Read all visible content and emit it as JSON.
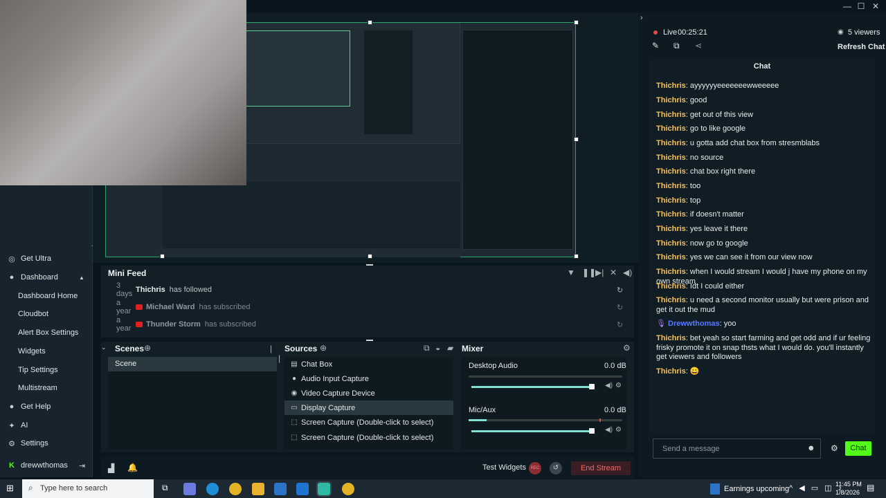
{
  "window": {
    "minimize": "—",
    "maximize": "☐",
    "close": "✕"
  },
  "sidebar": {
    "items": [
      {
        "icon": "get-ultra-icon",
        "glyph": "◎",
        "label": "Get Ultra"
      },
      {
        "icon": "dashboard-icon",
        "glyph": "●",
        "label": "Dashboard"
      },
      {
        "label": "Dashboard Home"
      },
      {
        "label": "Cloudbot"
      },
      {
        "label": "Alert Box Settings"
      },
      {
        "label": "Widgets"
      },
      {
        "label": "Tip Settings"
      },
      {
        "label": "Multistream"
      },
      {
        "icon": "help-icon",
        "glyph": "●",
        "label": "Get Help"
      },
      {
        "icon": "ai-icon",
        "glyph": "✦",
        "label": "AI"
      },
      {
        "icon": "settings-icon",
        "glyph": "⚙",
        "label": "Settings"
      },
      {
        "icon": "kick-icon",
        "glyph": "K",
        "label": "drewwthomas"
      }
    ]
  },
  "minifeed": {
    "title": "Mini Feed",
    "rows": [
      {
        "time": "3 days",
        "name": "Thichris",
        "action": "has followed",
        "platform": ""
      },
      {
        "time": "a year",
        "name": "Michael Ward",
        "action": "has subscribed",
        "platform": "youtube"
      },
      {
        "time": "a year",
        "name": "Thunder Storm",
        "action": "has subscribed",
        "platform": "youtube"
      }
    ]
  },
  "scenes": {
    "title": "Scenes",
    "items": [
      "Scene"
    ]
  },
  "sources": {
    "title": "Sources",
    "items": [
      {
        "icon": "chat-icon",
        "glyph": "💬",
        "label": "Chat Box"
      },
      {
        "icon": "mic-icon",
        "glyph": "●",
        "label": "Audio Input Capture"
      },
      {
        "icon": "camera-icon",
        "glyph": "◉",
        "label": "Video Capture Device"
      },
      {
        "icon": "monitor-icon",
        "glyph": "▭",
        "label": "Display Capture",
        "selected": true
      },
      {
        "icon": "screen-capture-icon",
        "glyph": "⬚",
        "label": "Screen Capture (Double-click to select)"
      },
      {
        "icon": "screen-capture-icon",
        "glyph": "⬚",
        "label": "Screen Capture (Double-click to select)"
      }
    ]
  },
  "mixer": {
    "title": "Mixer",
    "channels": [
      {
        "name": "Desktop Audio",
        "level": "0.0 dB",
        "volume": 0.98
      },
      {
        "name": "Mic/Aux",
        "level": "0.0 dB",
        "volume": 0.98
      }
    ]
  },
  "footer": {
    "test_widgets": "Test Widgets",
    "rec": "REC",
    "end_stream": "End Stream"
  },
  "chat": {
    "live_label": "Live",
    "live_time": "00:25:21",
    "viewers": "5 viewers",
    "refresh": "Refresh Chat",
    "title": "Chat",
    "messages": [
      {
        "user": "Thichris",
        "text": ": ayyyyyyeeeeeeewweeeee"
      },
      {
        "user": "Thichris",
        "text": ": good"
      },
      {
        "user": "Thichris",
        "text": ": get out of this view"
      },
      {
        "user": "Thichris",
        "text": ": go to like google"
      },
      {
        "user": "Thichris",
        "text": ": u gotta add chat box from stresmblabs"
      },
      {
        "user": "Thichris",
        "text": ": no source"
      },
      {
        "user": "Thichris",
        "text": ": chat box right there"
      },
      {
        "user": "Thichris",
        "text": ": too"
      },
      {
        "user": "Thichris",
        "text": ": top"
      },
      {
        "user": "Thichris",
        "text": ": if doesn't matter"
      },
      {
        "user": "Thichris",
        "text": ": yes leave it there"
      },
      {
        "user": "Thichris",
        "text": ": now go to google"
      },
      {
        "user": "Thichris",
        "text": ": yes we can see it from our view now"
      },
      {
        "user": "Thichris",
        "text": ": when I would stream I would j have my phone on my own stream"
      },
      {
        "user": "Thichris",
        "text": ": Idt I could either"
      },
      {
        "user": "Thichris",
        "text": ": u need a second monitor usually but were prison and get it out the mud"
      },
      {
        "user": "Drewwthomas",
        "text": ": yoo",
        "blue": true
      },
      {
        "user": "Thichris",
        "text": ": bet yeah so start farming and get odd and if ur feeling frisky promote it on snap thsts what I would do. you'll instantly get viewers and followers"
      },
      {
        "user": "Thichris",
        "text": ": 😀"
      }
    ],
    "input_placeholder": "Send a message",
    "send": "Chat"
  },
  "taskbar": {
    "search_placeholder": "Type here to search",
    "news": "Earnings upcoming",
    "time": "11:45 PM",
    "date": "1/8/2026"
  }
}
